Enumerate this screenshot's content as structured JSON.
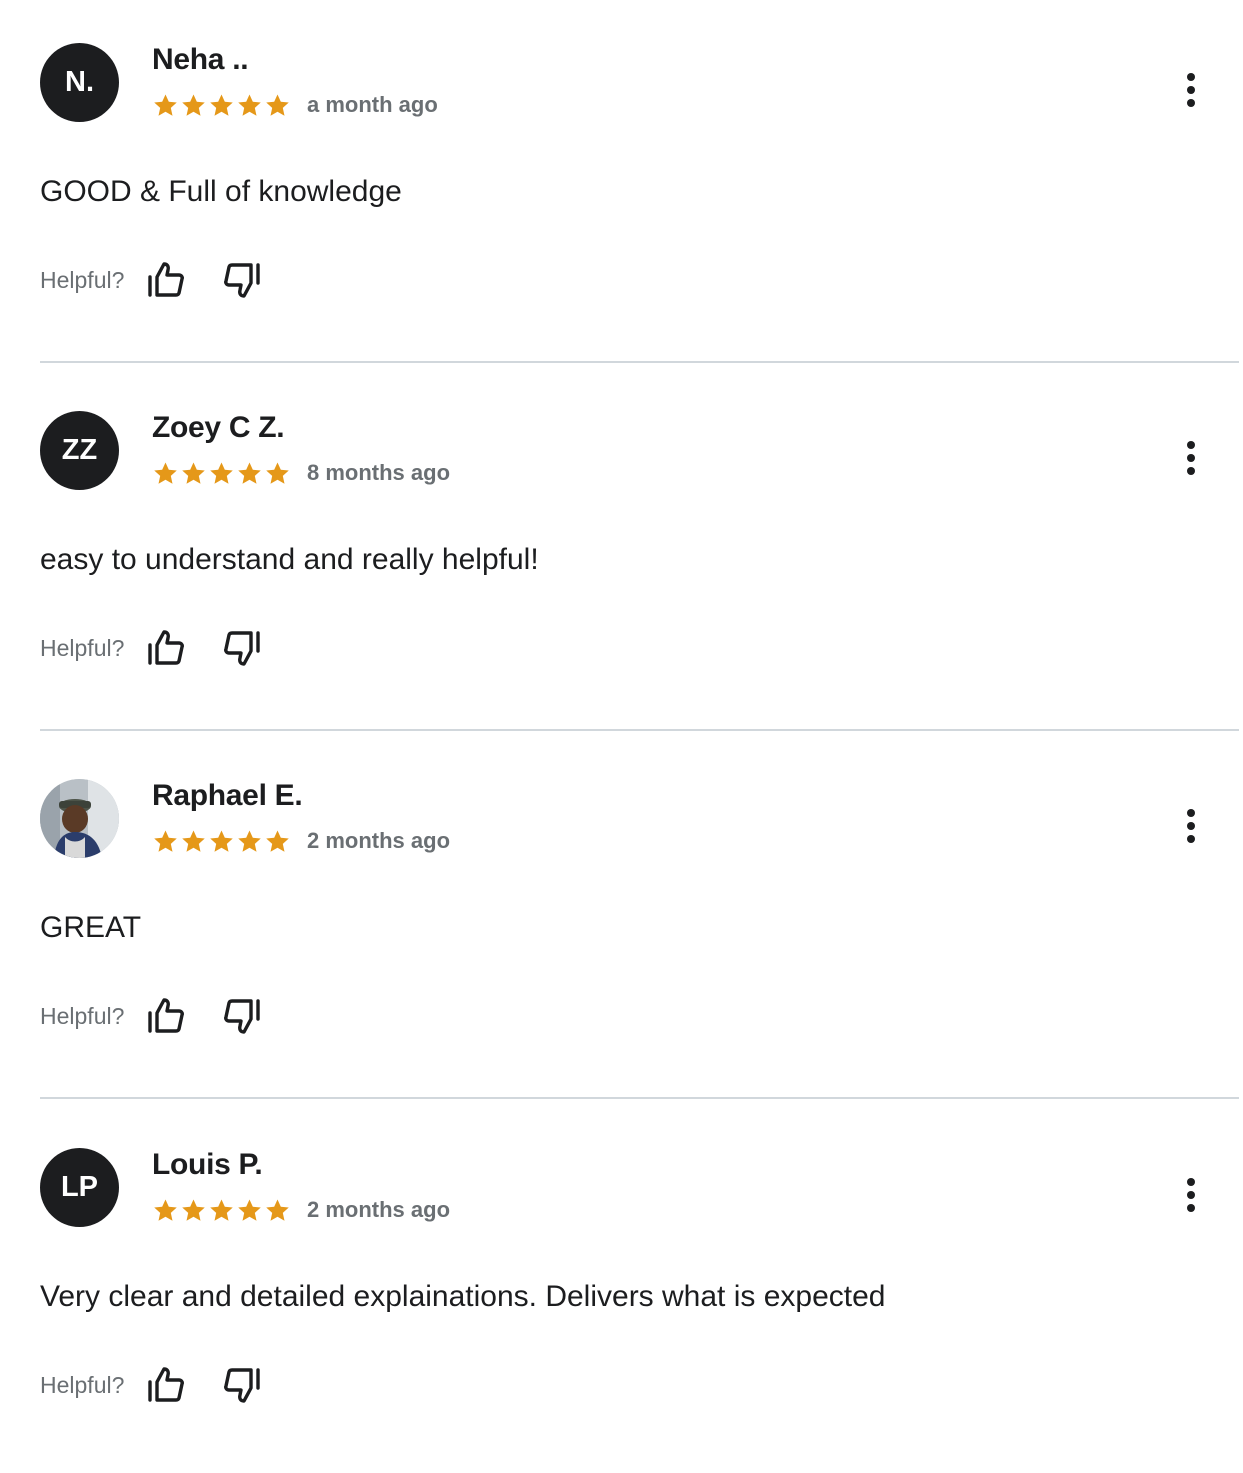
{
  "colors": {
    "star": "#e59819",
    "text": "#1c1d1f",
    "muted": "#6a6f73",
    "divider": "#d1d7dc",
    "avatar_bg": "#1c1d1f"
  },
  "helpful_label": "Helpful?",
  "reviews": [
    {
      "initials": "N.",
      "name": "Neha ..",
      "rating": 5,
      "time": "a month ago",
      "text": "GOOD & Full of knowledge",
      "avatar_icon": null
    },
    {
      "initials": "ZZ",
      "name": "Zoey C Z.",
      "rating": 5,
      "time": "8 months ago",
      "text": "easy to understand and really helpful!",
      "avatar_icon": null
    },
    {
      "initials": "",
      "name": "Raphael E.",
      "rating": 5,
      "time": "2 months ago",
      "text": "GREAT",
      "avatar_icon": "user-photo"
    },
    {
      "initials": "LP",
      "name": "Louis P.",
      "rating": 5,
      "time": "2 months ago",
      "text": "Very clear and detailed explainations. Delivers what is expected",
      "avatar_icon": null
    }
  ]
}
